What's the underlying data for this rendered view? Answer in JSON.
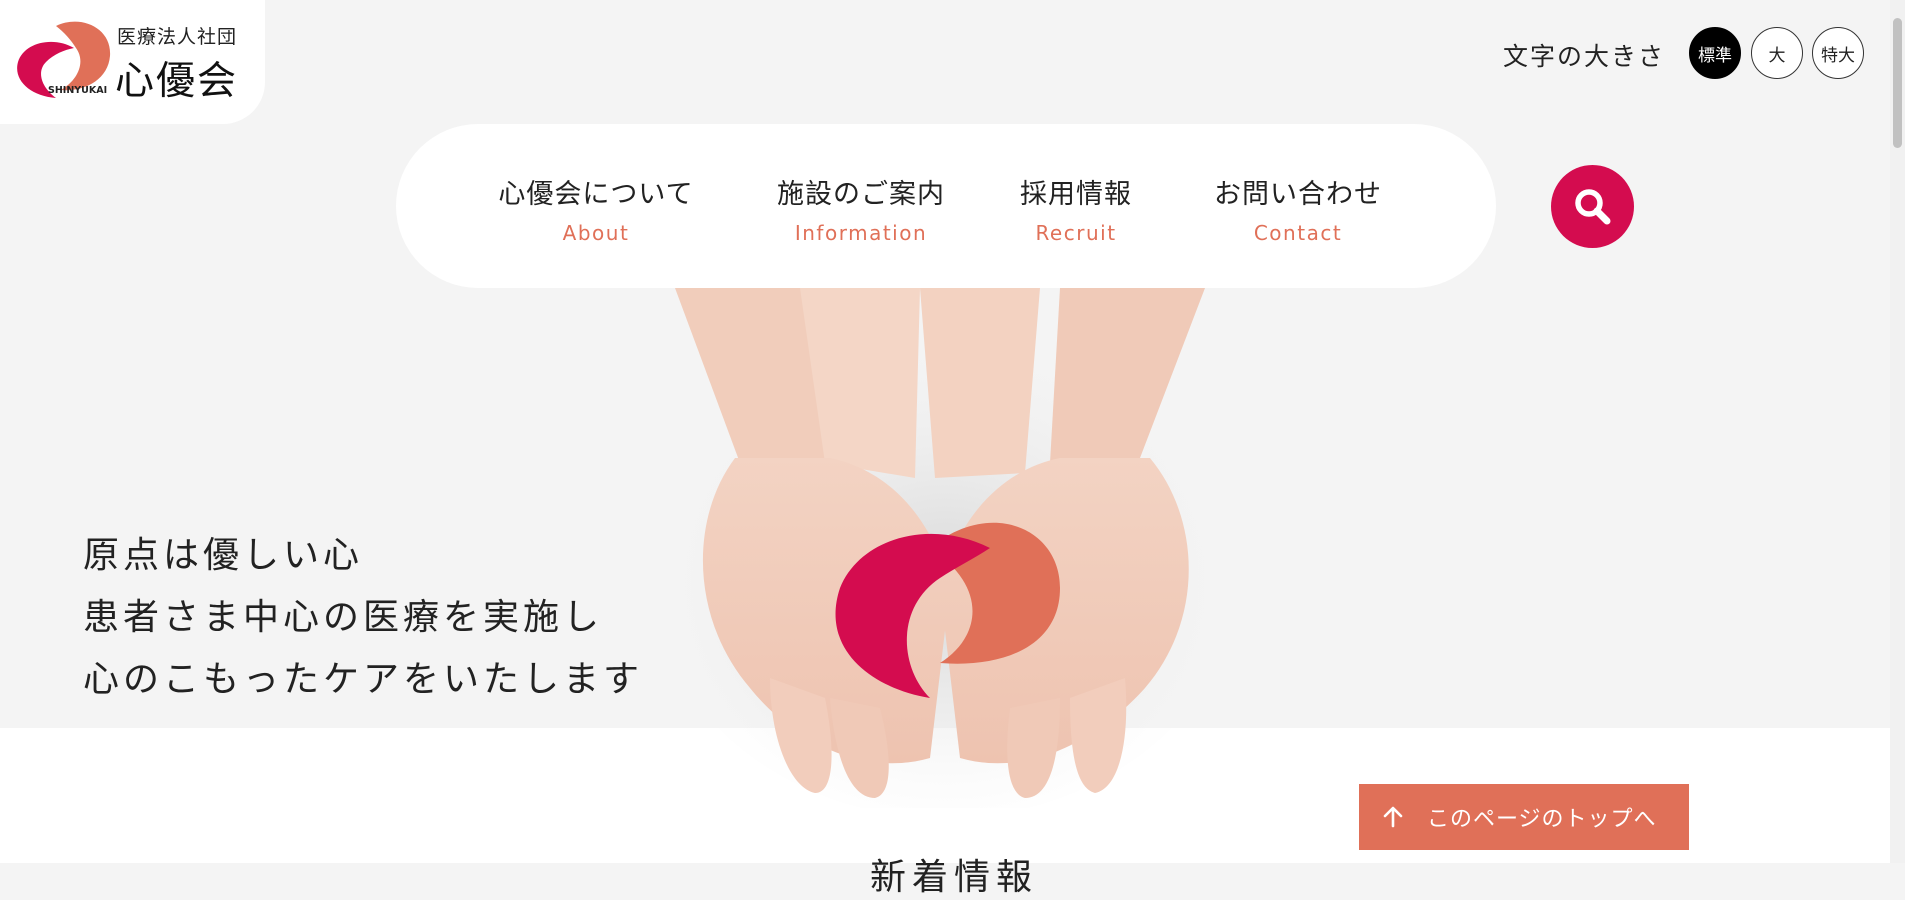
{
  "logo": {
    "sub_title": "医療法人社団",
    "main_title": "心優会",
    "en_name": "SHINYUKAI",
    "colors": {
      "crimson": "#d40c4f",
      "coral": "#e07058"
    }
  },
  "font_size": {
    "label": "文字の大きさ",
    "options": [
      "標準",
      "大",
      "特大"
    ],
    "selected": "標準"
  },
  "nav": {
    "items": [
      {
        "jp": "心優会について",
        "en": "About"
      },
      {
        "jp": "施設のご案内",
        "en": "Information"
      },
      {
        "jp": "採用情報",
        "en": "Recruit"
      },
      {
        "jp": "お問い合わせ",
        "en": "Contact"
      }
    ],
    "search_icon": "search-icon",
    "accent_color": "#e07058",
    "search_color": "#d40c4f"
  },
  "hero": {
    "lines": [
      "原点は優しい心",
      "患者さま中心の医療を実施し",
      "心のこもったケアをいたします"
    ]
  },
  "to_top": {
    "label": "このページのトップへ",
    "icon": "arrow-up-icon"
  },
  "news": {
    "heading": "新着情報"
  }
}
